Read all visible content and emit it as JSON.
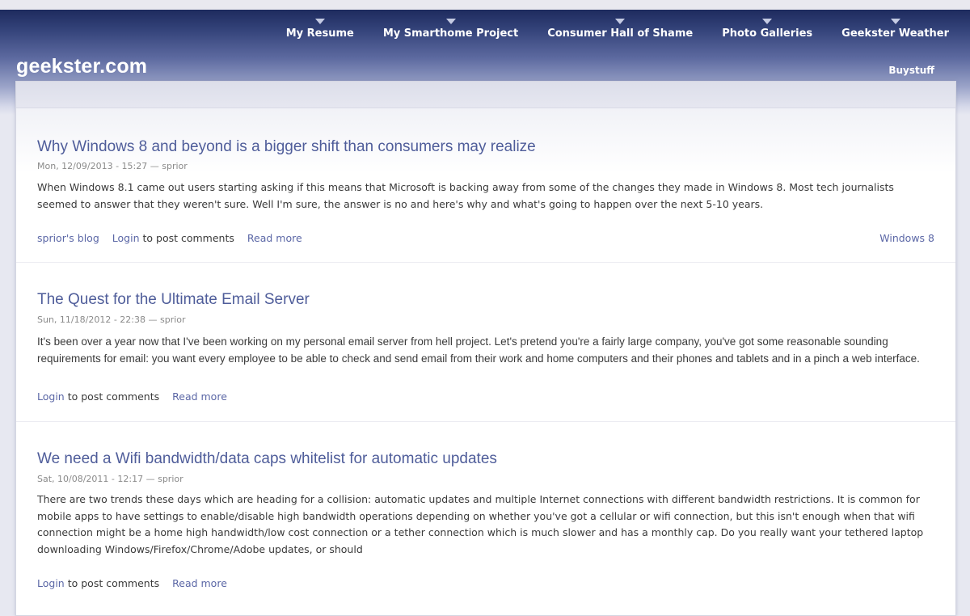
{
  "site": {
    "name": "geekster.com"
  },
  "primary_nav": [
    {
      "label": "My Resume"
    },
    {
      "label": "My Smarthome Project"
    },
    {
      "label": "Consumer Hall of Shame"
    },
    {
      "label": "Photo Galleries"
    },
    {
      "label": "Geekster Weather"
    }
  ],
  "secondary_nav": {
    "label": "Buystuff"
  },
  "posts": [
    {
      "title": "Why Windows 8 and beyond is a bigger shift than consumers may realize",
      "meta": "Mon, 12/09/2013 - 15:27 — sprior",
      "body": "When Windows 8.1 came out users starting asking if this means that Microsoft is backing away from some of the changes they made in Windows 8.  Most tech journalists seemed to answer that they weren't sure.  Well I'm sure, the answer is no and here's why and what's going to happen over the next 5-10 years.",
      "blog_link": "sprior's blog",
      "login_link": "Login",
      "login_suffix": "to post comments",
      "read_more": "Read more",
      "tag": "Windows 8"
    },
    {
      "title": "The Quest for the Ultimate Email Server",
      "meta": "Sun, 11/18/2012 - 22:38 — sprior",
      "body": "It's been over a year now that I've been working on my personal email server from hell project. Let's pretend you're a fairly large company, you've got some reasonable sounding requirements for email: you want every employee to be able to check and send email from their work and home computers and their phones and tablets and in a pinch a web interface.",
      "login_link": "Login",
      "login_suffix": "to post comments",
      "read_more": "Read more"
    },
    {
      "title": "We need a Wifi bandwidth/data caps whitelist for automatic updates",
      "meta": "Sat, 10/08/2011 - 12:17 — sprior",
      "body": "There are two trends these days which are heading for a collision: automatic updates and multiple Internet connections with different bandwidth restrictions.  It is common for mobile apps to have settings to enable/disable high bandwidth operations depending on whether you've got a cellular or wifi connection, but this isn't enough when that wifi connection might be a home high handwidth/low cost connection or a tether connection which is much slower and has a monthly cap.  Do you really want your tethered laptop downloading Windows/Firefox/Chrome/Adobe updates, or should",
      "login_link": "Login",
      "login_suffix": "to post comments",
      "read_more": "Read more"
    }
  ]
}
